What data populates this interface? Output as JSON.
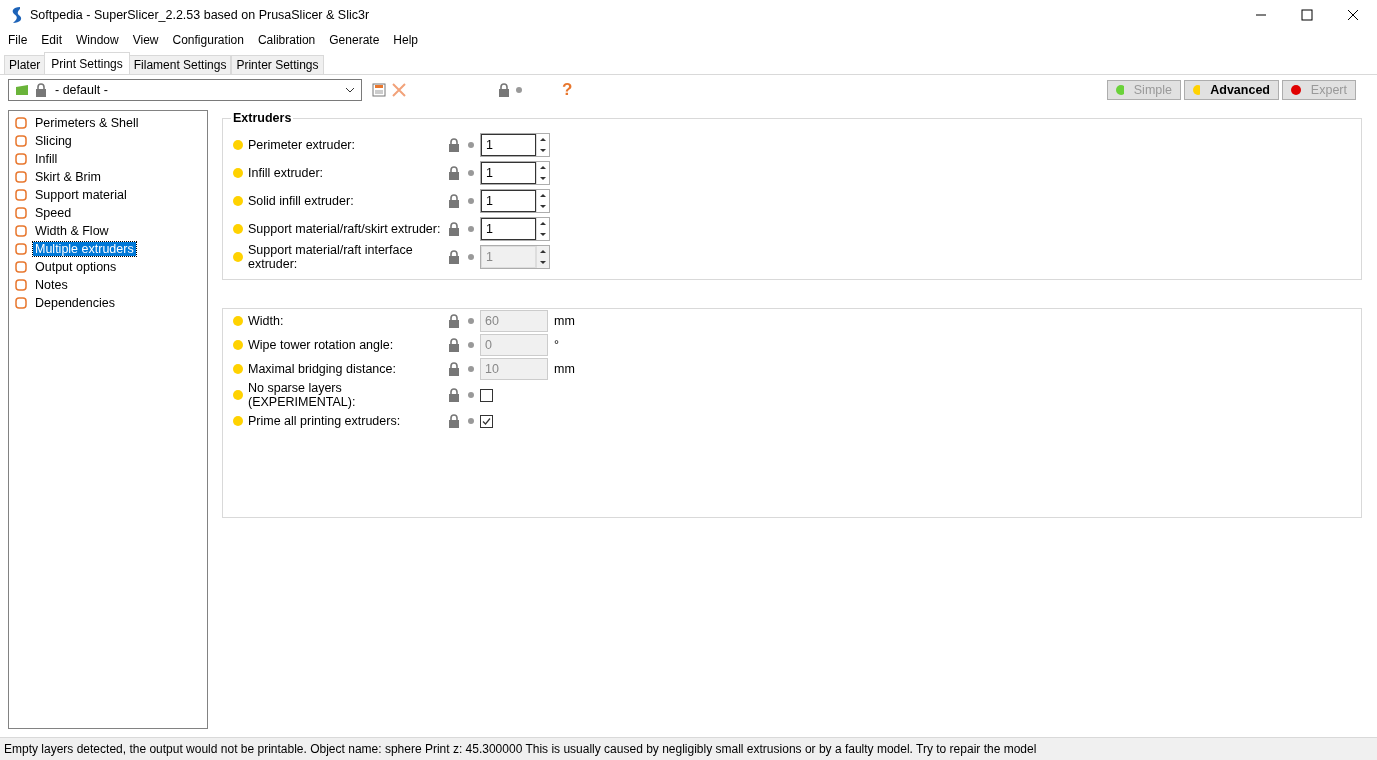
{
  "window": {
    "title": "Softpedia - SuperSlicer_2.2.53 based on PrusaSlicer & Slic3r"
  },
  "menu": [
    "File",
    "Edit",
    "Window",
    "View",
    "Configuration",
    "Calibration",
    "Generate",
    "Help"
  ],
  "tabs": [
    {
      "label": "Plater",
      "selected": false
    },
    {
      "label": "Print Settings",
      "selected": true
    },
    {
      "label": "Filament Settings",
      "selected": false
    },
    {
      "label": "Printer Settings",
      "selected": false
    }
  ],
  "preset": {
    "value": "- default -",
    "help": "?"
  },
  "modes": [
    {
      "label": "Simple",
      "selected": false,
      "color": "#6ad23a"
    },
    {
      "label": "Advanced",
      "selected": true,
      "color": "#ffd200"
    },
    {
      "label": "Expert",
      "selected": false,
      "color": "#e00000"
    }
  ],
  "sidebar": {
    "items": [
      {
        "label": "Perimeters & Shell",
        "selected": false
      },
      {
        "label": "Slicing",
        "selected": false
      },
      {
        "label": "Infill",
        "selected": false
      },
      {
        "label": "Skirt & Brim",
        "selected": false
      },
      {
        "label": "Support material",
        "selected": false
      },
      {
        "label": "Speed",
        "selected": false
      },
      {
        "label": "Width & Flow",
        "selected": false
      },
      {
        "label": "Multiple extruders",
        "selected": true
      },
      {
        "label": "Output options",
        "selected": false
      },
      {
        "label": "Notes",
        "selected": false
      },
      {
        "label": "Dependencies",
        "selected": false
      }
    ]
  },
  "groups": [
    {
      "title": "Extruders",
      "options": [
        {
          "kind": "spin",
          "label": "Perimeter extruder:",
          "value": "1",
          "disabled": false
        },
        {
          "kind": "spin",
          "label": "Infill extruder:",
          "value": "1",
          "disabled": false
        },
        {
          "kind": "spin",
          "label": "Solid infill extruder:",
          "value": "1",
          "disabled": false
        },
        {
          "kind": "spin",
          "label": "Support material/raft/skirt extruder:",
          "value": "1",
          "disabled": false
        },
        {
          "kind": "spin",
          "label": "Support material/raft interface extruder:",
          "value": "1",
          "disabled": true
        }
      ]
    },
    {
      "options": [
        {
          "kind": "number",
          "label": "Width:",
          "value": "60",
          "unit": "mm",
          "disabled": true
        },
        {
          "kind": "number",
          "label": "Wipe tower rotation angle:",
          "value": "0",
          "unit": "°",
          "disabled": true
        },
        {
          "kind": "number",
          "label": "Maximal bridging distance:",
          "value": "10",
          "unit": "mm",
          "disabled": true
        },
        {
          "kind": "checkbox",
          "label": "No sparse layers (EXPERIMENTAL):",
          "checked": false
        },
        {
          "kind": "checkbox",
          "label": "Prime all printing extruders:",
          "checked": true
        }
      ]
    }
  ],
  "status_bar": "Empty layers detected, the output would not be printable.  Object name: sphere Print z: 45.300000  This is usually caused by negligibly small extrusions or by a faulty model. Try to repair the model"
}
